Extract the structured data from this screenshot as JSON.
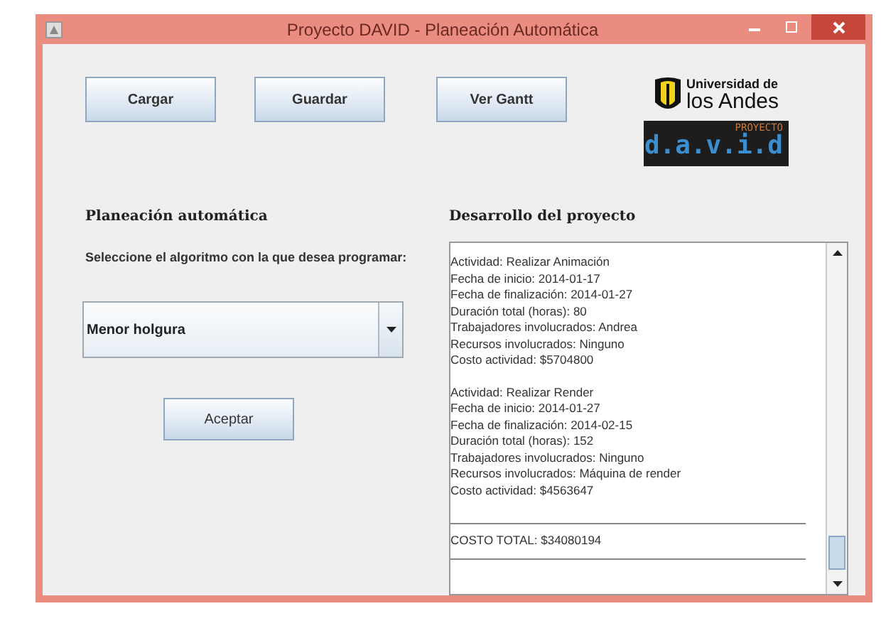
{
  "window": {
    "title": "Proyecto DAVID - Planeación Automática"
  },
  "toolbar_buttons": [
    "Cargar",
    "Guardar",
    "Ver Gantt"
  ],
  "logo": {
    "university_line_1": "Universidad de",
    "university_line_2": "los Andes",
    "project_tag": "PROYECTO",
    "project_name": "d.a.v.i.d"
  },
  "planning": {
    "heading": "Planeación automática",
    "prompt": "Seleccione el algoritmo con la que desea programar:",
    "algorithm": "Menor holgura",
    "accept_button": "Aceptar"
  },
  "development": {
    "heading": "Desarrollo del proyecto",
    "lines": [
      {
        "kind": "text",
        "text": "Actividad: Realizar Animación"
      },
      {
        "kind": "text",
        "text": "Fecha de inicio: 2014-01-17"
      },
      {
        "kind": "text",
        "text": "Fecha de finalización: 2014-01-27"
      },
      {
        "kind": "text",
        "text": "Duración total (horas): 80"
      },
      {
        "kind": "text",
        "text": "Trabajadores involucrados: Andrea"
      },
      {
        "kind": "text",
        "text": "Recursos involucrados: Ninguno"
      },
      {
        "kind": "text",
        "text": "Costo actividad:  $5704800"
      },
      {
        "kind": "gap"
      },
      {
        "kind": "text",
        "text": "Actividad: Realizar Render"
      },
      {
        "kind": "text",
        "text": "Fecha de inicio: 2014-01-27"
      },
      {
        "kind": "text",
        "text": "Fecha de finalización: 2014-02-15"
      },
      {
        "kind": "text",
        "text": "Duración total (horas): 152"
      },
      {
        "kind": "text",
        "text": "Trabajadores involucrados: Ninguno"
      },
      {
        "kind": "text",
        "text": "Recursos involucrados: Máquina de render"
      },
      {
        "kind": "text",
        "text": "Costo actividad:  $4563647"
      },
      {
        "kind": "gap"
      },
      {
        "kind": "rule"
      },
      {
        "kind": "text",
        "text": "COSTO TOTAL: $34080194"
      },
      {
        "kind": "rule"
      }
    ]
  }
}
